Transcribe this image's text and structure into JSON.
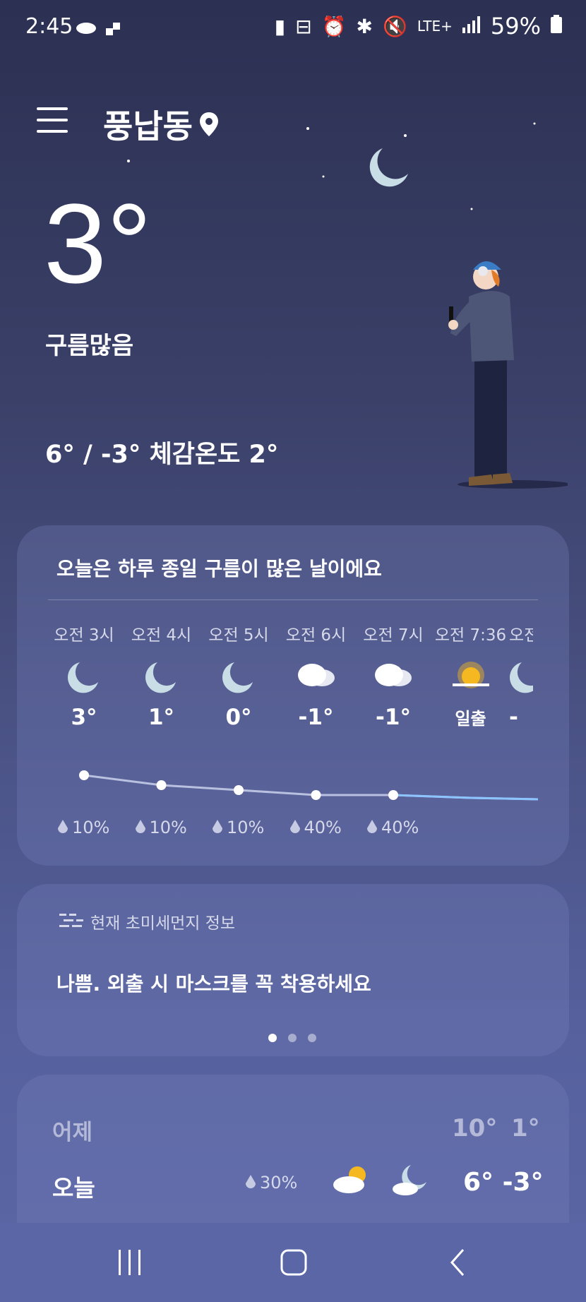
{
  "status_bar": {
    "time": "2:45",
    "network": "LTE+",
    "battery": "59%"
  },
  "header": {
    "location": "풍납동"
  },
  "current": {
    "temperature": "3°",
    "condition": "구름많음",
    "minmax": "6° / -3° 체감온도 2°"
  },
  "hourly": {
    "summary": "오늘은 하루 종일 구름이 많은 날이에요",
    "items": [
      {
        "time": "오전 3시",
        "icon": "moon-icon",
        "temp": "3°",
        "precip": "10%",
        "value": 3
      },
      {
        "time": "오전 4시",
        "icon": "moon-icon",
        "temp": "1°",
        "precip": "10%",
        "value": 1
      },
      {
        "time": "오전 5시",
        "icon": "moon-icon",
        "temp": "0°",
        "precip": "10%",
        "value": 0
      },
      {
        "time": "오전 6시",
        "icon": "cloud-icon",
        "temp": "-1°",
        "precip": "40%",
        "value": -1
      },
      {
        "time": "오전 7시",
        "icon": "cloud-icon",
        "temp": "-1°",
        "precip": "40%",
        "value": -1
      },
      {
        "time": "오전 7:36",
        "icon": "sunrise-icon",
        "temp": "일출",
        "precip": "",
        "value": null
      },
      {
        "time": "오전",
        "icon": "moon-icon",
        "temp": "-",
        "precip": "",
        "value": null
      }
    ]
  },
  "dust": {
    "title": "현재 초미세먼지 정보",
    "message": "나쁨. 외출 시 마스크를 꼭 착용하세요"
  },
  "daily": {
    "yesterday_label": "어제",
    "yesterday_high": "10°",
    "yesterday_low": "1°",
    "today_label": "오늘",
    "today_precip": "30%",
    "today_temps": "6° -3°"
  },
  "colors": {
    "moon": "#c8dde6",
    "sun": "#f5b820",
    "line": "#8cc4ff"
  }
}
